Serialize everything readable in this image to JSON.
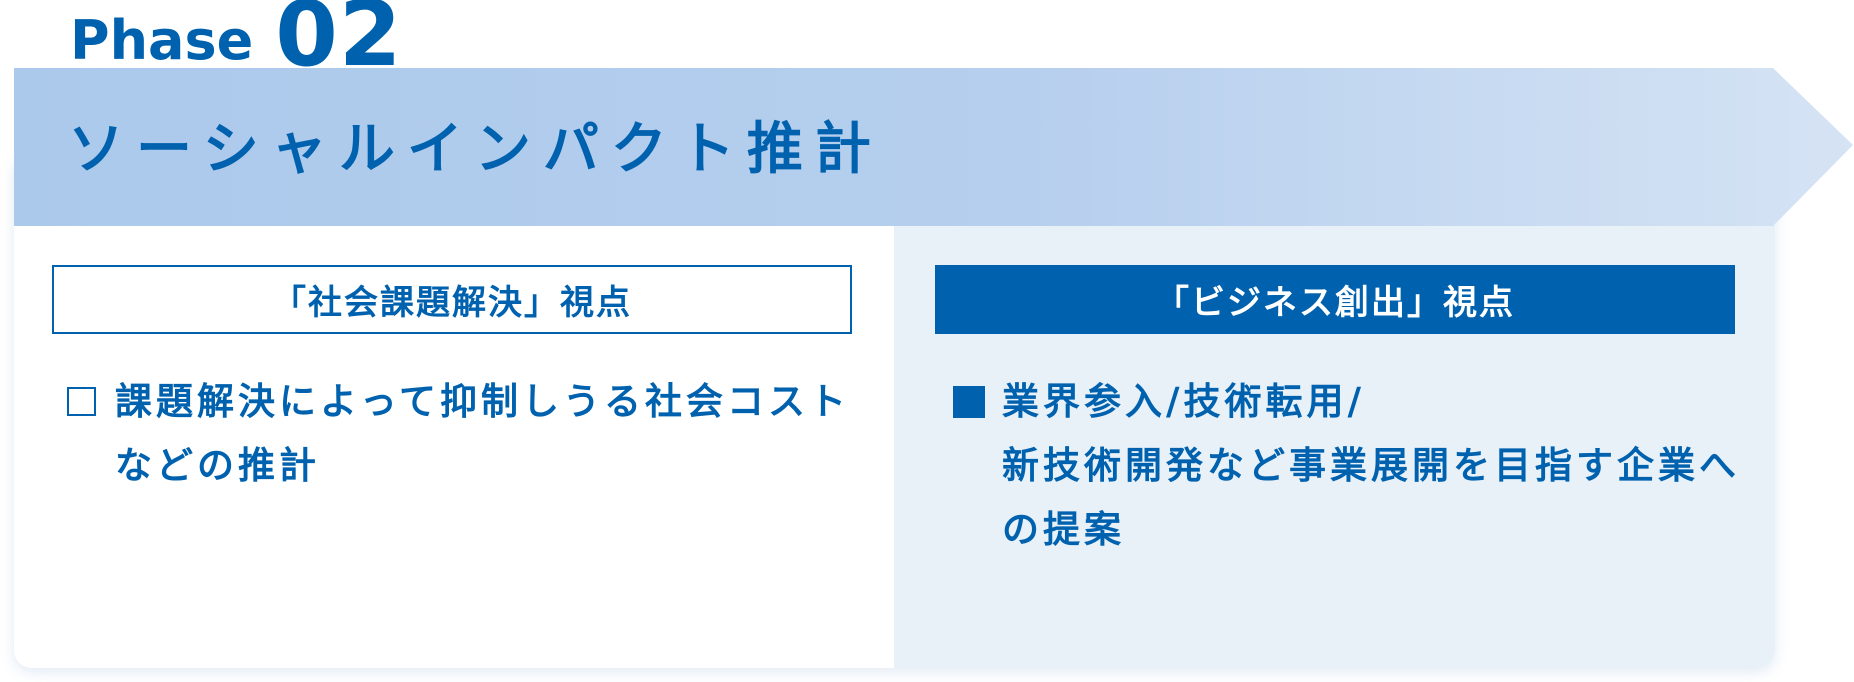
{
  "phase": {
    "word": "Phase",
    "number": "02"
  },
  "title": "ソーシャルインパクト推計",
  "colors": {
    "accent": "#0062ae",
    "banner_start": "#abc9eb",
    "banner_end": "#d5e3f4",
    "right_panel_bg": "#e8f0f8"
  },
  "columns": [
    {
      "header": "「社会課題解決」視点",
      "bullet_style": "outline-square",
      "lines": [
        "課題解決によって抑制しうる社会コスト",
        "などの推計"
      ]
    },
    {
      "header": "「ビジネス創出」視点",
      "bullet_style": "filled-square",
      "lines": [
        "業界参入/技術転用/",
        "新技術開発など事業展開を目指す企業へ",
        "の提案"
      ]
    }
  ]
}
